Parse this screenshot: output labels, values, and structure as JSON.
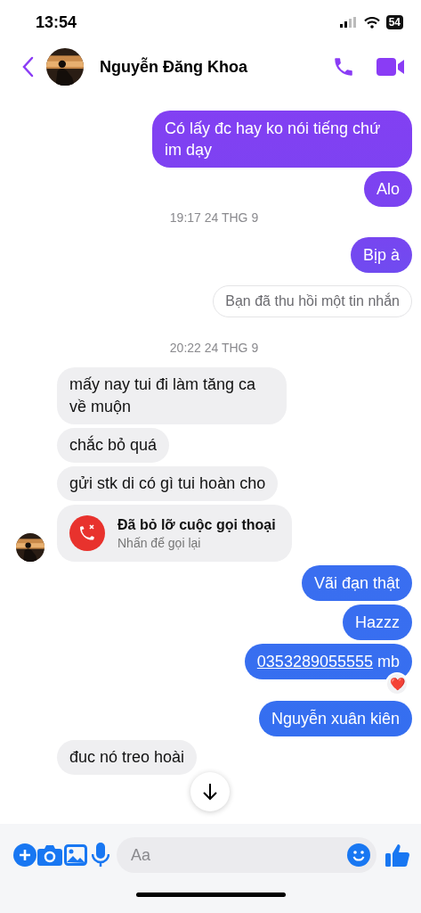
{
  "status_bar": {
    "time": "13:54",
    "battery": "54"
  },
  "header": {
    "contact_name": "Nguyễn Đăng Khoa"
  },
  "messages": [
    {
      "kind": "out",
      "text": "Có lấy đc hay ko nói tiếng chứ im dạy"
    },
    {
      "kind": "out",
      "text": "Alo"
    },
    {
      "kind": "timestamp",
      "text": "19:17 24 THG 9"
    },
    {
      "kind": "out",
      "text": "Bịp à"
    },
    {
      "kind": "unsent",
      "text": "Bạn đã thu hồi một tin nhắn"
    },
    {
      "kind": "timestamp",
      "text": "20:22 24 THG 9"
    },
    {
      "kind": "in",
      "text": "mấy nay tui đi làm tăng ca về muộn"
    },
    {
      "kind": "in",
      "text": "chắc bỏ quá"
    },
    {
      "kind": "in",
      "text": "gửi stk di có gì tui hoàn cho"
    },
    {
      "kind": "missed_call",
      "title": "Đã bỏ lỡ cuộc gọi thoại",
      "subtitle": "Nhấn để gọi lại"
    },
    {
      "kind": "out",
      "text": "Vãi đạn thật"
    },
    {
      "kind": "out",
      "text": "Hazzz"
    },
    {
      "kind": "out",
      "link": "0353289055555",
      "text": " mb",
      "reaction": "❤️"
    },
    {
      "kind": "out",
      "text": "Nguyễn xuân kiên"
    },
    {
      "kind": "in",
      "text": "đuc nó treo hoài"
    }
  ],
  "composer": {
    "placeholder": "Aa"
  }
}
